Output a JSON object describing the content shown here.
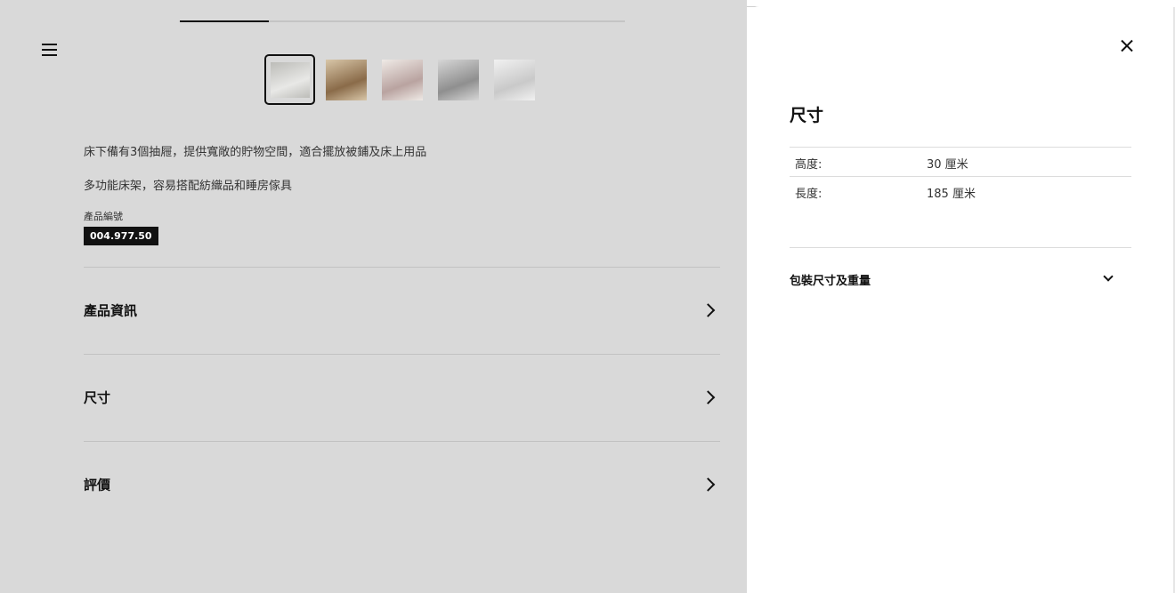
{
  "carousel": {
    "progress": 0.2,
    "thumbnails": [
      {
        "alt": "bed-product",
        "colors": [
          "#e8e8e6",
          "#bcbcb8"
        ]
      },
      {
        "alt": "bedroom-scene-wood",
        "colors": [
          "#8a6b49",
          "#d8c6a8"
        ]
      },
      {
        "alt": "bedroom-scene-pink",
        "colors": [
          "#b9a3a0",
          "#efeae6"
        ]
      },
      {
        "alt": "bedroom-scene-grey",
        "colors": [
          "#8f8f8f",
          "#d6d6d6"
        ]
      },
      {
        "alt": "drawer-detail",
        "colors": [
          "#c9c9c9",
          "#f1f1f1"
        ]
      }
    ]
  },
  "product": {
    "desc_1": "床下備有3個抽屜，提供寬敞的貯物空間，適合擺放被鋪及床上用品",
    "desc_2": "多功能床架，容易搭配紡織品和睡房傢具",
    "sku_label": "產品編號",
    "sku": "004.977.50"
  },
  "accordion": {
    "product_info": "產品資訊",
    "dimensions": "尺寸",
    "reviews": "評價"
  },
  "panel": {
    "title": "尺寸",
    "rows": [
      {
        "key": "高度:",
        "value": "30 厘米"
      },
      {
        "key": "長度:",
        "value": "185 厘米"
      }
    ],
    "package_label": "包裝尺寸及重量"
  },
  "colors": {
    "overlay": "#d9d9d9",
    "text": "#111111",
    "sku_bg": "#111111"
  }
}
